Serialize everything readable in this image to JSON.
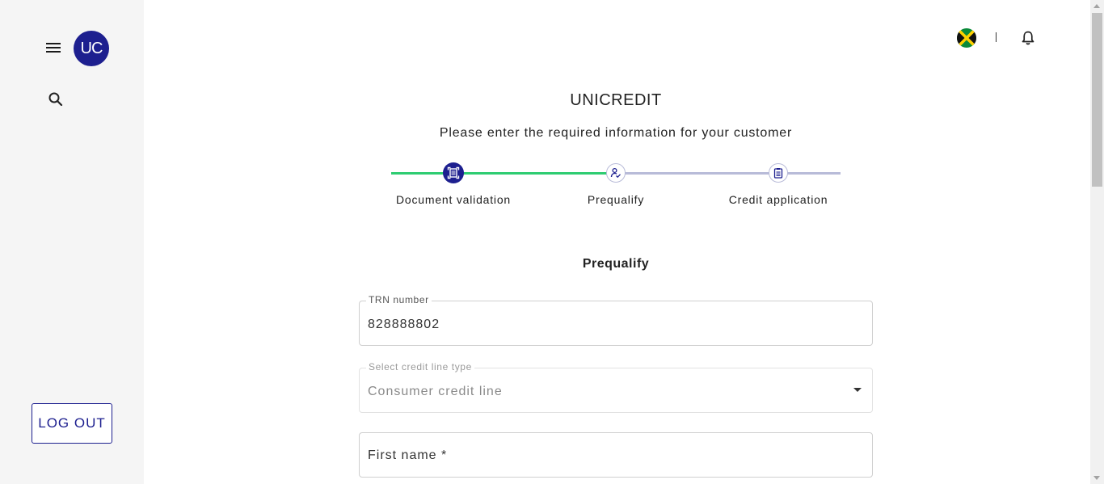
{
  "brand": {
    "logo_text": "UC",
    "color": "#1d1f8f"
  },
  "sidebar": {
    "logout_label": "LOG OUT"
  },
  "header": {
    "flag": "jamaica-flag-icon",
    "divider": "|"
  },
  "page": {
    "title": "UNICREDIT",
    "subtitle": "Please enter the required information for your customer",
    "section_title": "Prequalify"
  },
  "stepper": {
    "steps": [
      {
        "label": "Document validation",
        "icon": "document-scan-icon",
        "state": "active"
      },
      {
        "label": "Prequalify",
        "icon": "user-check-icon",
        "state": "current"
      },
      {
        "label": "Credit application",
        "icon": "clipboard-icon",
        "state": "pending"
      }
    ],
    "colors": {
      "done": "#2ecc71",
      "pending": "#b8bbd8",
      "accent": "#1d1f8f"
    }
  },
  "form": {
    "trn": {
      "label": "TRN number",
      "value": "828888802"
    },
    "credit_line": {
      "label": "Select credit line type",
      "value": "Consumer credit line"
    },
    "first_name": {
      "placeholder": "First name *"
    }
  }
}
